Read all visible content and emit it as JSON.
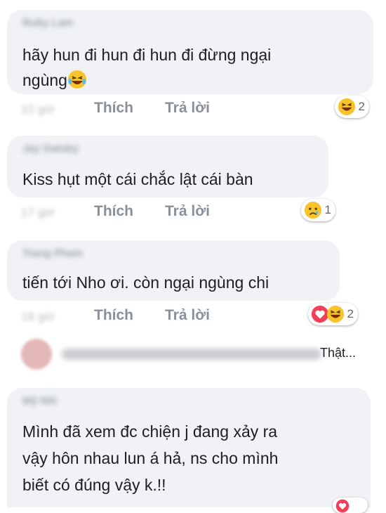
{
  "comments": [
    {
      "author": "Ruby Lam",
      "line1": "hãy hun đi hun đi hun đi đừng ngại",
      "line2": "ngùng",
      "time": "10 giờ",
      "like_label": "Thích",
      "reply_label": "Trả lời",
      "reaction_count": "2",
      "reaction_icons": [
        "laughing-emoji"
      ]
    },
    {
      "author": "Jay Gatsby",
      "line1": "Kiss hụt một cái chắc lật cái bàn",
      "time": "17 giờ",
      "like_label": "Thích",
      "reply_label": "Trả lời",
      "reaction_count": "1",
      "reaction_icons": [
        "sad-emoji"
      ]
    },
    {
      "author": "Trang Pham",
      "line1": "tiến tới Nho ơi. còn ngại ngùng chi",
      "time": "18 giờ",
      "like_label": "Thích",
      "reply_label": "Trả lời",
      "reaction_count": "2",
      "reaction_icons": [
        "love-icon",
        "laughing-emoji"
      ]
    },
    {
      "author": "Mỹ Nhi",
      "line1": "Mình đã xem đc chiện j đang xảy ra",
      "line2": "vậy  hôn nhau lun á hả, ns cho mình",
      "line3": "biết có đúng vậy k.!!"
    }
  ],
  "collapsed_reply": {
    "text": "Thật..."
  },
  "colors": {
    "bubble": "#f0f2f5",
    "text": "#1c1e21",
    "action": "#8a9099",
    "laugh_yellow": "#f7c52b",
    "love_red": "#f33e58"
  }
}
